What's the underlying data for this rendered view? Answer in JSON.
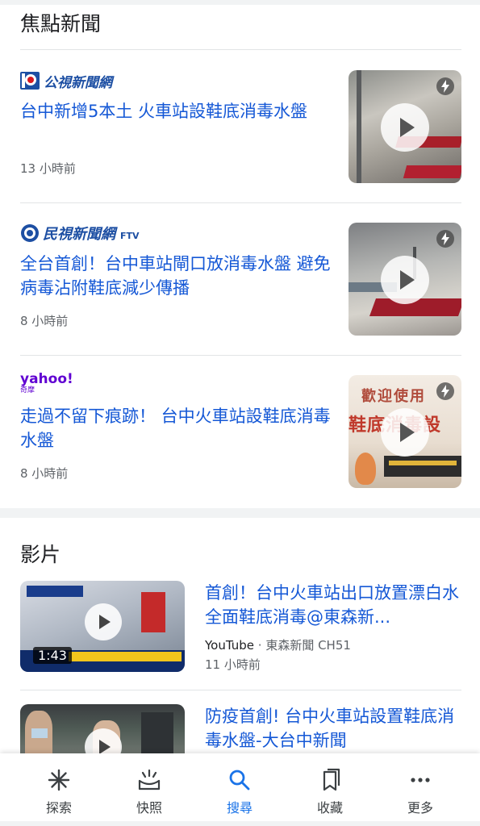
{
  "focus": {
    "title": "焦點新聞"
  },
  "news": [
    {
      "source": "公視新聞網",
      "headline": "台中新增5本土 火車站設鞋底消毒水盤",
      "time": "13 小時前",
      "thumb_icon": "amp-lightning-icon"
    },
    {
      "source": "民視新聞網",
      "source_suffix": "FTV",
      "headline": "全台首創！台中車站閘口放消毒水盤 避免病毒沾附鞋底減少傳播",
      "time": "8 小時前",
      "thumb_icon": "amp-lightning-icon"
    },
    {
      "source": "yahoo!",
      "source_sub": "奇摩",
      "headline": "走過不留下痕跡！ 台中火車站設鞋底消毒水盤",
      "time": "8 小時前",
      "thumb_icon": "amp-lightning-icon"
    }
  ],
  "videos_section": {
    "title": "影片"
  },
  "videos": [
    {
      "title": "首創！台中火車站出口放置漂白水全面鞋底消毒@東森新...",
      "platform": "YouTube",
      "channel": "· 東森新聞 CH51",
      "time": "11 小時前",
      "duration": "1:43"
    },
    {
      "title": "防疫首創! 台中火車站設置鞋底消毒水盤-大台中新聞"
    }
  ],
  "bottom_nav": [
    {
      "label": "探索",
      "icon": "asterisk-icon",
      "active": false
    },
    {
      "label": "快照",
      "icon": "snapshot-icon",
      "active": false
    },
    {
      "label": "搜尋",
      "icon": "search-icon",
      "active": true
    },
    {
      "label": "收藏",
      "icon": "collections-icon",
      "active": false
    },
    {
      "label": "更多",
      "icon": "more-dots-icon",
      "active": false
    }
  ],
  "colors": {
    "link": "#1558d6",
    "active_nav": "#1a73e8",
    "meta": "#5f6368",
    "pts_red": "#d71920",
    "ftv_blue": "#1d4fa3",
    "yahoo_purple": "#6001d2"
  }
}
